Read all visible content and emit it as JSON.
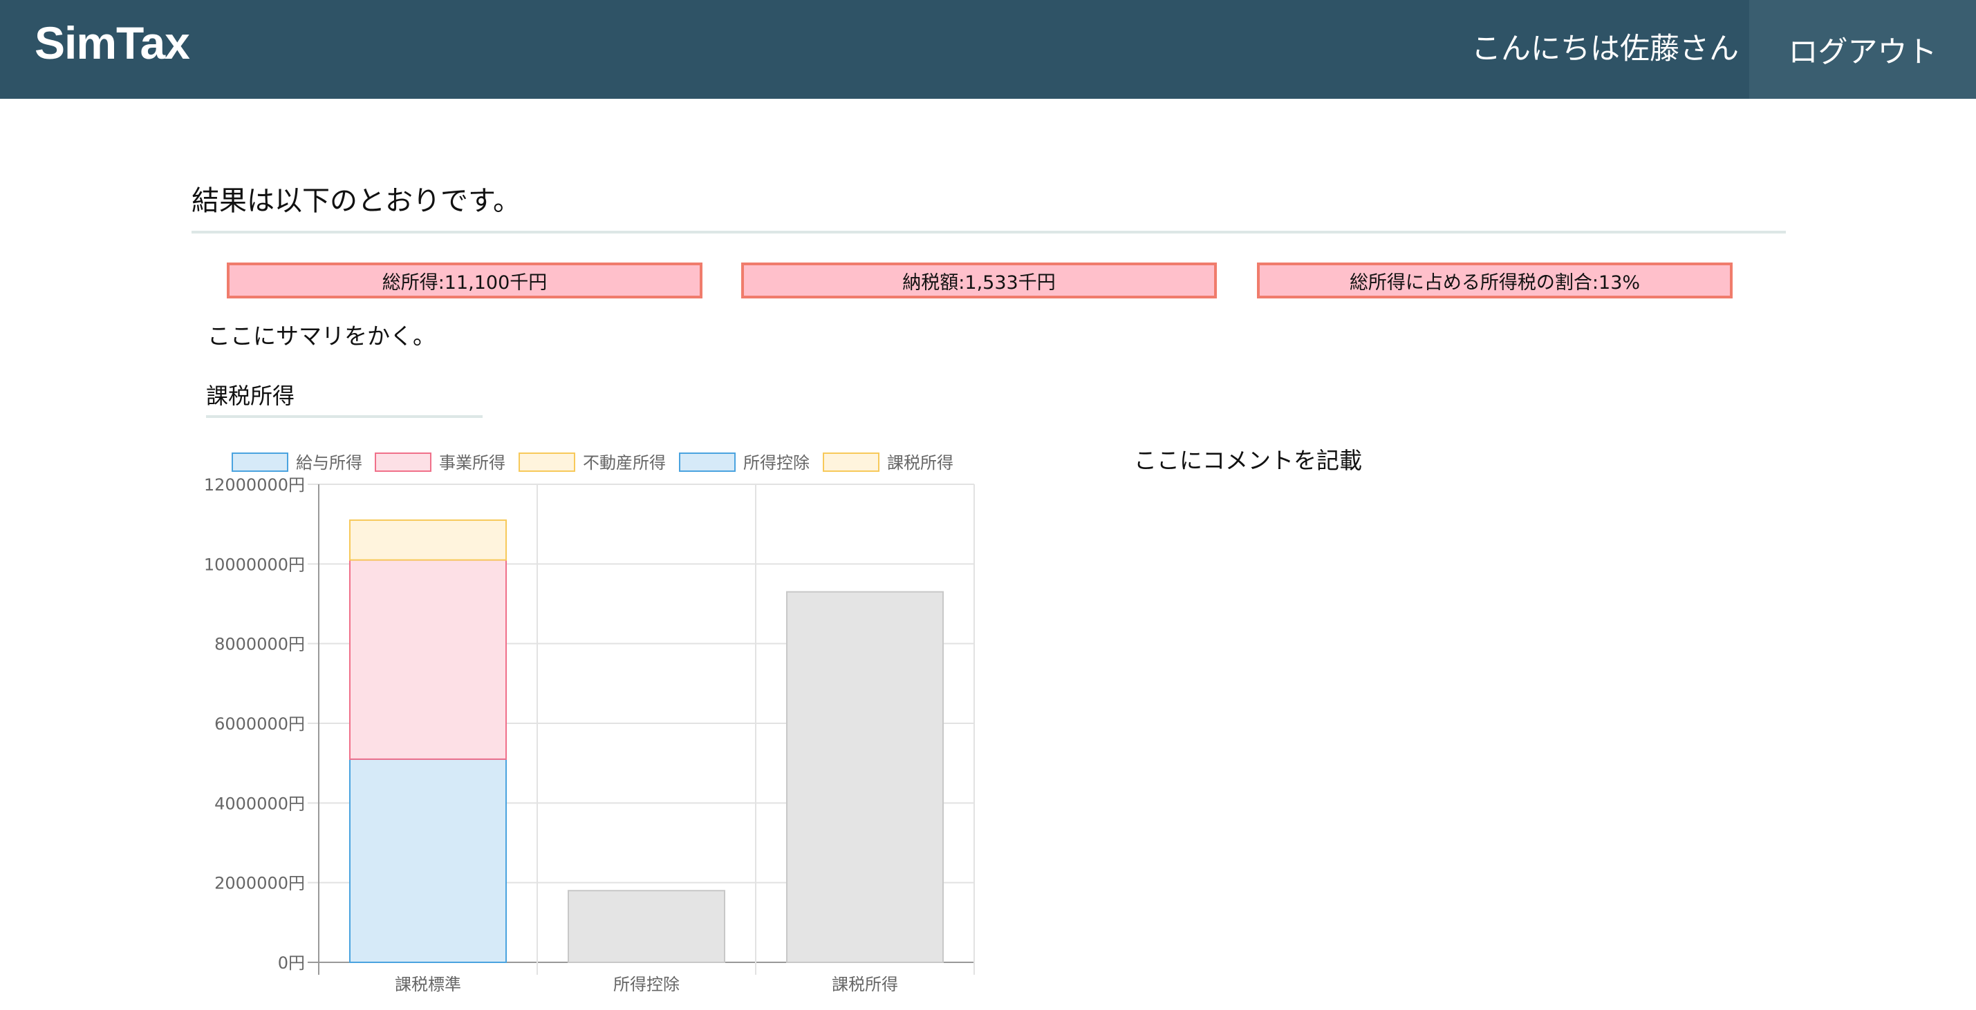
{
  "header": {
    "logo": "SimTax",
    "greeting": "こんにちは佐藤さん",
    "logout_label": "ログアウト"
  },
  "main": {
    "heading": "結果は以下のとおりです。",
    "stats": [
      {
        "label": "総所得:11,100千円"
      },
      {
        "label": "納税額:1,533千円"
      },
      {
        "label": "総所得に占める所得税の割合:13%"
      }
    ],
    "summary": "ここにサマリをかく。",
    "section_title": "課税所得",
    "comment": "ここにコメントを記載"
  },
  "colors": {
    "header_bg": "#2f5366",
    "stat_bg": "#ffc0cb",
    "stat_border": "#f07c6c"
  },
  "chart_data": {
    "type": "bar",
    "stacked": true,
    "categories": [
      "課税標準",
      "所得控除",
      "課税所得"
    ],
    "y_tick_values": [
      0,
      2000000,
      4000000,
      6000000,
      8000000,
      10000000,
      12000000
    ],
    "y_tick_suffix": "円",
    "ylim": [
      0,
      12000000
    ],
    "grid": true,
    "legend_position": "top",
    "series": [
      {
        "name": "給与所得",
        "values": [
          5100000,
          0,
          0
        ],
        "fill": "#d6eaf8",
        "stroke": "#4aa3df"
      },
      {
        "name": "事業所得",
        "values": [
          5000000,
          0,
          0
        ],
        "fill": "#fde0e6",
        "stroke": "#f0708a"
      },
      {
        "name": "不動産所得",
        "values": [
          1000000,
          0,
          0
        ],
        "fill": "#fff4dd",
        "stroke": "#f7c95a"
      },
      {
        "name": "所得控除",
        "values": [
          0,
          1800000,
          0
        ],
        "fill": "#e4e4e4",
        "stroke": "#c8c8c8",
        "legend_fill": "#d6eaf8",
        "legend_stroke": "#4aa3df"
      },
      {
        "name": "課税所得",
        "values": [
          0,
          0,
          9300000
        ],
        "fill": "#e4e4e4",
        "stroke": "#c8c8c8",
        "legend_fill": "#fff4dd",
        "legend_stroke": "#f7c95a"
      }
    ]
  }
}
